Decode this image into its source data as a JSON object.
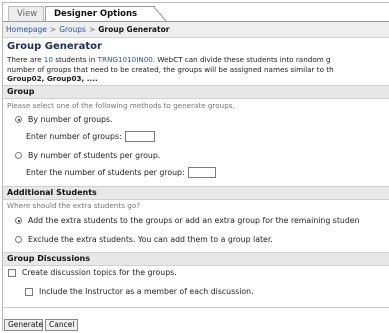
{
  "tabs": {
    "view": "View",
    "designer": "Designer Options"
  },
  "breadcrumb": {
    "home": "Homepage",
    "groups": "Groups",
    "current": "Group Generator",
    "sep": ">"
  },
  "page": {
    "title": "Group Generator",
    "intro_1a": "There are ",
    "intro_1b": "10",
    "intro_1c": " students in ",
    "intro_1d": "TRNG1010IN00",
    "intro_1e": ". WebCT can divide these students into random g",
    "intro_2": "number of groups that need to be created, the groups will be assigned names similar to th",
    "intro_3": "Group02, Group03, ...."
  },
  "group": {
    "header": "Group",
    "hint": "Please select one of the following methods to generate groups.",
    "by_number": "By number of groups.",
    "enter_number": "Enter number of groups:",
    "by_students": "By number of students per group.",
    "enter_students": "Enter the number of students per group:"
  },
  "additional": {
    "header": "Additional Students",
    "hint": "Where should the extra students go?",
    "add_option": "Add the extra students to the groups or add an extra group for the remaining studen",
    "exclude_option": "Exclude the extra students. You can add them to a group later."
  },
  "discussions": {
    "header": "Group Discussions",
    "create_topics": "Create discussion topics for the groups.",
    "include_instructor": "Include the Instructor as a member of each discussion."
  },
  "buttons": {
    "generate": "Generate",
    "cancel": "Cancel"
  }
}
